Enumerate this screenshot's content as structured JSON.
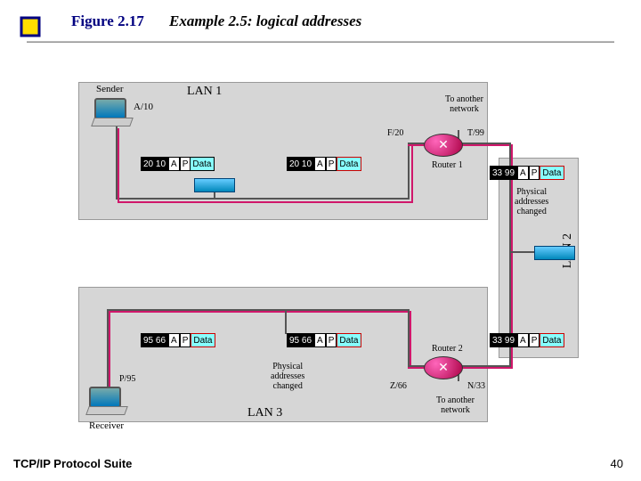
{
  "header": {
    "figure_label": "Figure 2.17",
    "example_label": "Example 2.5: logical addresses"
  },
  "footer": {
    "left": "TCP/IP Protocol Suite",
    "page": "40"
  },
  "diagram": {
    "lan1_label": "LAN 1",
    "lan2_label": "LAN 2",
    "lan3_label": "LAN 3",
    "sender": "Sender",
    "receiver": "Receiver",
    "router1": "Router 1",
    "router2": "Router 2",
    "to_another_network_top": "To another\nnetwork",
    "to_another_network_bottom": "To another\nnetwork",
    "phys_changed_top": "Physical\naddresses\nchanged",
    "phys_changed_bottom": "Physical\naddresses\nchanged",
    "addr_A10": "A/10",
    "addr_F20": "F/20",
    "addr_T99": "T/99",
    "addr_P95": "P/95",
    "addr_Z66": "Z/66",
    "addr_N33": "N/33",
    "packets": {
      "p1": {
        "mac": "20 10",
        "a": "A",
        "p": "P",
        "data": "Data"
      },
      "p2": {
        "mac": "20 10",
        "a": "A",
        "p": "P",
        "data": "Data"
      },
      "p3": {
        "mac": "33 99",
        "a": "A",
        "p": "P",
        "data": "Data"
      },
      "p4": {
        "mac": "95 66",
        "a": "A",
        "p": "P",
        "data": "Data"
      },
      "p5": {
        "mac": "95 66",
        "a": "A",
        "p": "P",
        "data": "Data"
      },
      "p6": {
        "mac": "33 99",
        "a": "A",
        "p": "P",
        "data": "Data"
      }
    }
  }
}
